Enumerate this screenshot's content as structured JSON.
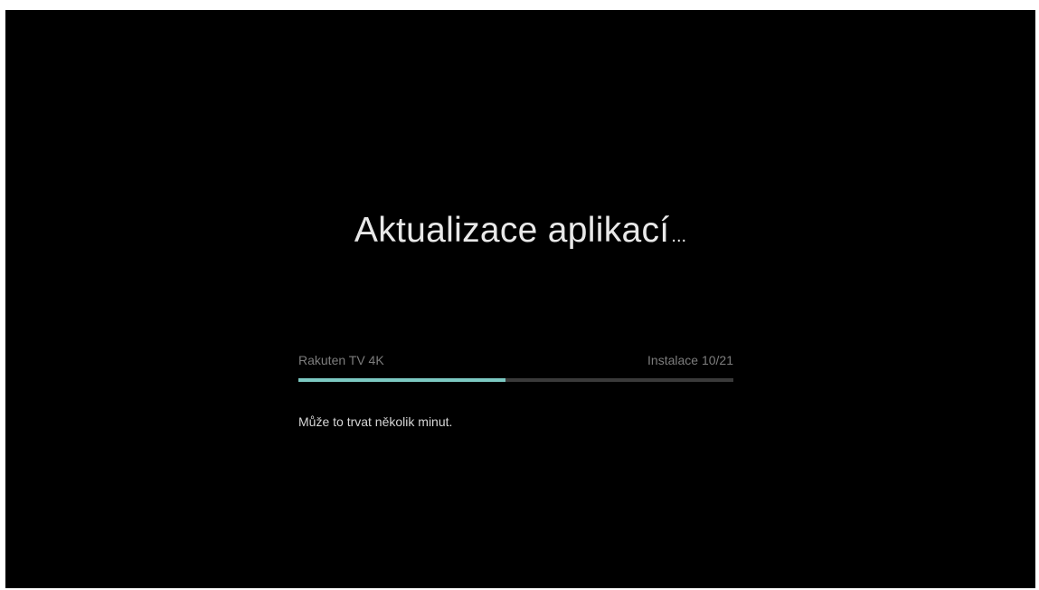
{
  "screen": {
    "title": "Aktualizace aplikací",
    "title_ellipsis": "...",
    "progress": {
      "app_name": "Rakuten TV 4K",
      "status": "Instalace 10/21",
      "fraction": 0.476,
      "bar_color": "#7cc9c2",
      "track_color": "#3a3a3a"
    },
    "note": "Může to trvat několik minut."
  }
}
